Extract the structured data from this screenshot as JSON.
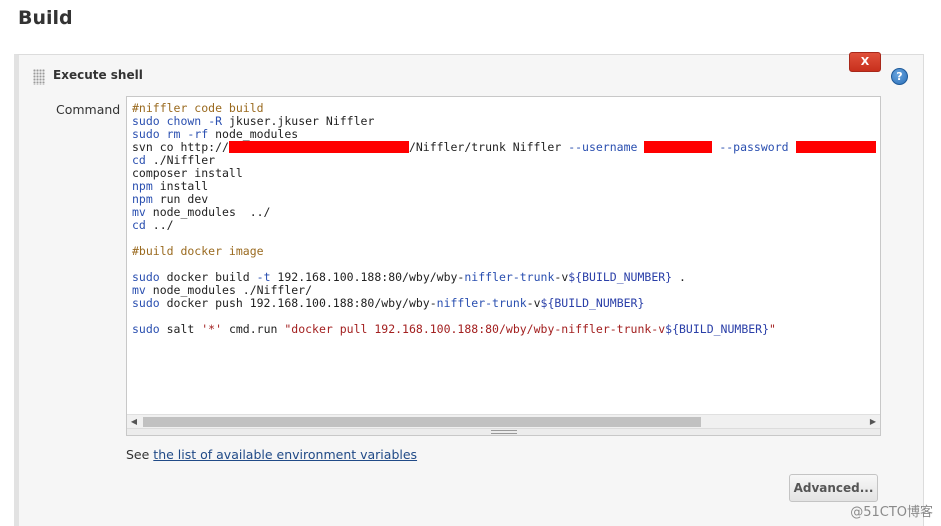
{
  "page": {
    "title": "Build"
  },
  "step": {
    "title": "Execute shell",
    "delete_label": "X",
    "help_label": "?",
    "command_label": "Command",
    "code_lines": [
      [
        {
          "t": "#niffler code build",
          "c": "com"
        }
      ],
      [
        {
          "t": "sudo chown",
          "c": "kw"
        },
        {
          "t": " ",
          "c": ""
        },
        {
          "t": "-R",
          "c": "kw"
        },
        {
          "t": " jkuser.jkuser Niffler",
          "c": ""
        }
      ],
      [
        {
          "t": "sudo rm",
          "c": "kw"
        },
        {
          "t": " ",
          "c": ""
        },
        {
          "t": "-rf",
          "c": "kw"
        },
        {
          "t": " node_modules",
          "c": ""
        }
      ],
      [
        {
          "t": "svn co http://",
          "c": ""
        },
        {
          "redact": 180
        },
        {
          "t": "/Niffler/trunk Niffler ",
          "c": ""
        },
        {
          "t": "--username",
          "c": "kw"
        },
        {
          "t": " ",
          "c": ""
        },
        {
          "redact": 68
        },
        {
          "t": " ",
          "c": ""
        },
        {
          "t": "--password",
          "c": "kw"
        },
        {
          "t": " ",
          "c": ""
        },
        {
          "redact": 80
        }
      ],
      [
        {
          "t": "cd",
          "c": "kw"
        },
        {
          "t": " ./Niffler",
          "c": ""
        }
      ],
      [
        {
          "t": "composer install",
          "c": ""
        }
      ],
      [
        {
          "t": "npm",
          "c": "kw"
        },
        {
          "t": " install",
          "c": ""
        }
      ],
      [
        {
          "t": "npm",
          "c": "kw"
        },
        {
          "t": " run dev",
          "c": ""
        }
      ],
      [
        {
          "t": "mv",
          "c": "kw"
        },
        {
          "t": " node_modules  ../",
          "c": ""
        }
      ],
      [
        {
          "t": "cd",
          "c": "kw"
        },
        {
          "t": " ../",
          "c": ""
        }
      ],
      [],
      [
        {
          "t": "#build docker image",
          "c": "com"
        }
      ],
      [],
      [
        {
          "t": "sudo",
          "c": "kw"
        },
        {
          "t": " docker build ",
          "c": ""
        },
        {
          "t": "-t",
          "c": "kw"
        },
        {
          "t": " 192.168.100.188:80/wby/wby-",
          "c": ""
        },
        {
          "t": "niffler-trunk",
          "c": "kw"
        },
        {
          "t": "-v",
          "c": ""
        },
        {
          "t": "${BUILD_NUMBER}",
          "c": "var"
        },
        {
          "t": " .",
          "c": ""
        }
      ],
      [
        {
          "t": "mv",
          "c": "kw"
        },
        {
          "t": " node_modules ./Niffler/",
          "c": ""
        }
      ],
      [
        {
          "t": "sudo",
          "c": "kw"
        },
        {
          "t": " docker push 192.168.100.188:80/wby/wby-",
          "c": ""
        },
        {
          "t": "niffler-trunk",
          "c": "kw"
        },
        {
          "t": "-v",
          "c": ""
        },
        {
          "t": "${BUILD_NUMBER}",
          "c": "var"
        }
      ],
      [],
      [
        {
          "t": "sudo",
          "c": "kw"
        },
        {
          "t": " salt ",
          "c": ""
        },
        {
          "t": "'*'",
          "c": "str"
        },
        {
          "t": " cmd.run ",
          "c": ""
        },
        {
          "t": "\"docker pull 192.168.100.188:80/wby/wby-niffler-trunk-v",
          "c": "str"
        },
        {
          "t": "${BUILD_NUMBER}",
          "c": "var"
        },
        {
          "t": "\"",
          "c": "str"
        }
      ]
    ],
    "see_prefix": "See ",
    "env_link": "the list of available environment variables",
    "advanced_label": "Advanced..."
  },
  "watermark": "@51CTO博客"
}
